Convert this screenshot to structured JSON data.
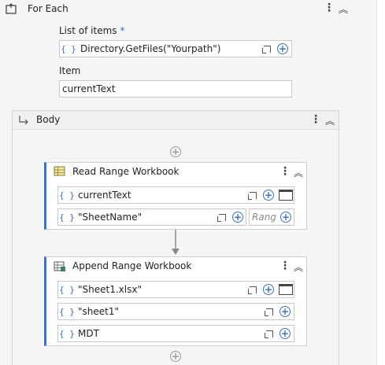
{
  "foreach": {
    "title": "For Each",
    "list_label": "List of items",
    "required_mark": "*",
    "list_value": "Directory.GetFiles(\"Yourpath\")",
    "item_label": "Item",
    "item_value": "currentText"
  },
  "body": {
    "title": "Body"
  },
  "read_range": {
    "title": "Read Range Workbook",
    "path_value": "currentText",
    "sheet_value": "\"SheetName\"",
    "range_placeholder": "Rang"
  },
  "append_range": {
    "title": "Append Range Workbook",
    "path_value": "\"Sheet1.xlsx\"",
    "sheet_value": "\"sheet1\"",
    "data_value": "MDT"
  },
  "glyphs": {
    "curly": "{ }",
    "kebab": "⋮",
    "chevron": "︽",
    "plus": "+"
  },
  "colors": {
    "accent": "#3b6fd4",
    "background": "#f5f5f5",
    "card": "#ffffff"
  }
}
